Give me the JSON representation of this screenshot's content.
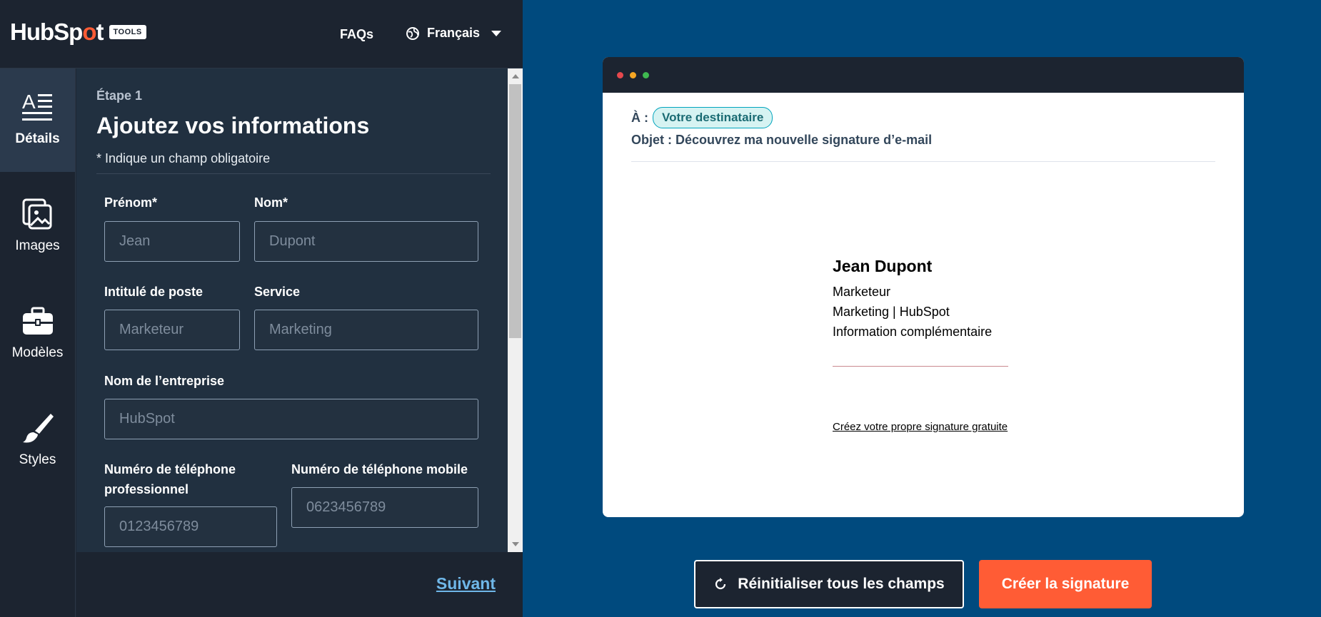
{
  "header": {
    "logo_word_a": "HubSp",
    "logo_sprocket": "o",
    "logo_word_b": "t",
    "logo_badge": "TOOLS",
    "faqs_label": "FAQs",
    "language_label": "Français"
  },
  "sidebar": {
    "items": [
      {
        "label": "Détails",
        "icon": "details-icon",
        "active": true
      },
      {
        "label": "Images",
        "icon": "images-icon",
        "active": false
      },
      {
        "label": "Modèles",
        "icon": "toolbox-icon",
        "active": false
      },
      {
        "label": "Styles",
        "icon": "brush-icon",
        "active": false
      }
    ]
  },
  "form": {
    "step": "Étape 1",
    "title": "Ajoutez vos informations",
    "required_note": "* Indique un champ obligatoire",
    "fields": {
      "first_name": {
        "label": "Prénom*",
        "placeholder": "Jean"
      },
      "last_name": {
        "label": "Nom*",
        "placeholder": "Dupont"
      },
      "job_title": {
        "label": "Intitulé de poste",
        "placeholder": "Marketeur"
      },
      "department": {
        "label": "Service",
        "placeholder": "Marketing"
      },
      "company": {
        "label": "Nom de l’entreprise",
        "placeholder": "HubSpot"
      },
      "office_phone": {
        "label_line1": "Numéro de téléphone",
        "label_line2": "professionnel",
        "placeholder": "0123456789"
      },
      "mobile_phone": {
        "label": "Numéro de téléphone mobile",
        "placeholder": "0623456789"
      }
    },
    "next_label": "Suivant"
  },
  "preview": {
    "to_label": "À :",
    "recipient": "Votre destinataire",
    "subject": "Objet : Découvrez ma nouvelle signature d’e-mail",
    "window_dots": [
      "#e5484d",
      "#f5a623",
      "#3fb950"
    ],
    "signature": {
      "name": "Jean Dupont",
      "title": "Marketeur",
      "dept_company": "Marketing | HubSpot",
      "extra": "Information complémentaire",
      "cta_link": "Créez votre propre signature gratuite"
    }
  },
  "actions": {
    "reset_label": "Réinitialiser tous les champs",
    "create_label": "Créer la signature"
  },
  "colors": {
    "brand_orange": "#ff5c35",
    "panel_blue": "#004a7e",
    "dark_navy": "#1c2430",
    "link_blue": "#6fb7e8"
  }
}
